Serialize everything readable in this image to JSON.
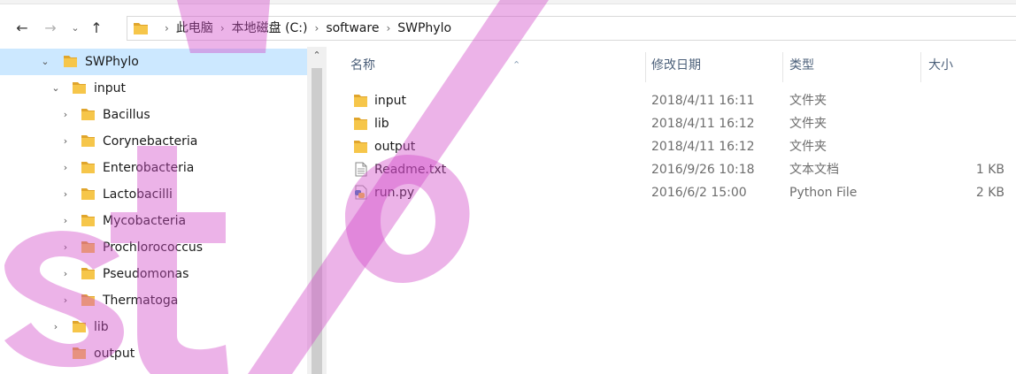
{
  "address": {
    "nav": {
      "back": "←",
      "forward": "→",
      "recent": "⌄",
      "up": "↑"
    },
    "breadcrumb": [
      "此电脑",
      "本地磁盘 (C:)",
      "software",
      "SWPhylo"
    ],
    "separator": "›"
  },
  "tree": [
    {
      "label": "SWPhylo",
      "expander": "⌄",
      "selected": true
    },
    {
      "label": "input",
      "expander": "⌄"
    },
    {
      "label": "Bacillus",
      "expander": "›"
    },
    {
      "label": "Corynebacteria",
      "expander": "›"
    },
    {
      "label": "Enterobacteria",
      "expander": "›"
    },
    {
      "label": "Lactobacilli",
      "expander": "›"
    },
    {
      "label": "Mycobacteria",
      "expander": "›"
    },
    {
      "label": "Prochlorococcus",
      "expander": "›"
    },
    {
      "label": "Pseudomonas",
      "expander": "›"
    },
    {
      "label": "Thermatoga",
      "expander": "›"
    },
    {
      "label": "lib",
      "expander": "›"
    },
    {
      "label": "output",
      "expander": ""
    }
  ],
  "pane_scroll_up": "⌃",
  "columns": {
    "name": "名称",
    "modified": "修改日期",
    "type": "类型",
    "size": "大小",
    "sort_indicator": "⌃"
  },
  "files": [
    {
      "name": "input",
      "modified": "2018/4/11 16:11",
      "type": "文件夹",
      "size": "",
      "icon": "folder-icon"
    },
    {
      "name": "lib",
      "modified": "2018/4/11 16:12",
      "type": "文件夹",
      "size": "",
      "icon": "folder-icon"
    },
    {
      "name": "output",
      "modified": "2018/4/11 16:12",
      "type": "文件夹",
      "size": "",
      "icon": "folder-icon"
    },
    {
      "name": "Readme.txt",
      "modified": "2016/9/26 10:18",
      "type": "文本文档",
      "size": "1 KB",
      "icon": "text-file-icon"
    },
    {
      "name": "run.py",
      "modified": "2016/6/2 15:00",
      "type": "Python File",
      "size": "2 KB",
      "icon": "python-file-icon"
    }
  ],
  "colors": {
    "folder": "#f6c64a",
    "folder_dark": "#e0a52c",
    "selection": "#cce8ff",
    "watermark": "#d24bc8"
  }
}
